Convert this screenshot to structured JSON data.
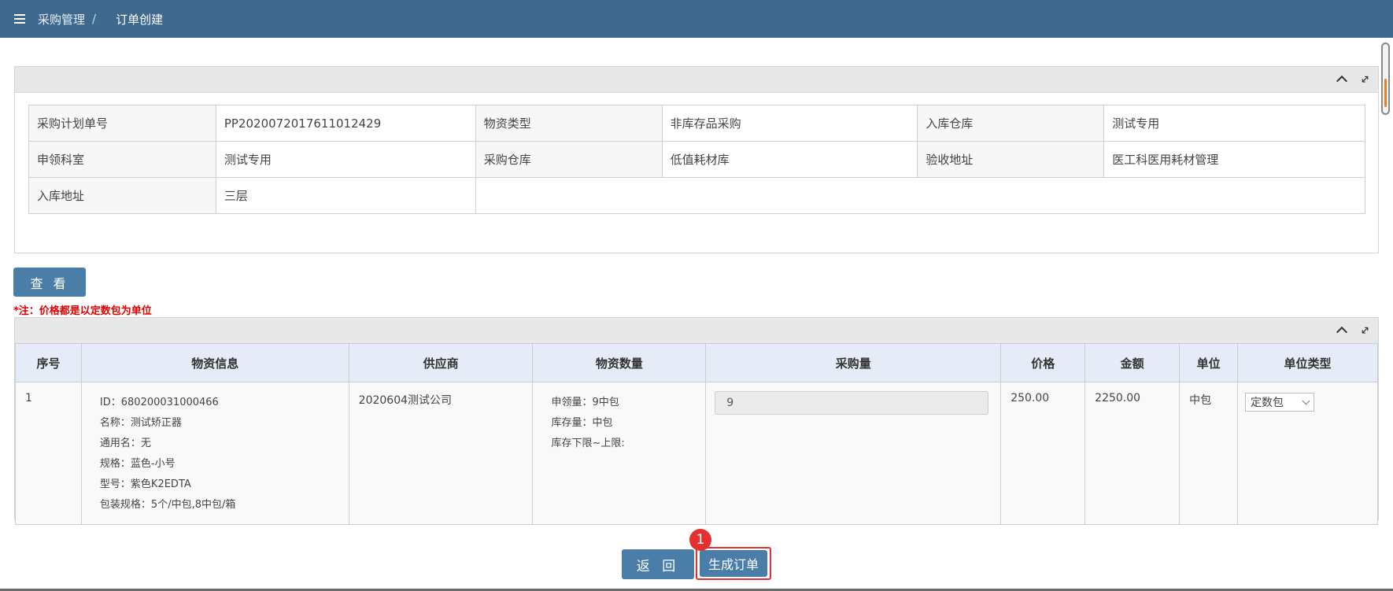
{
  "breadcrumb": {
    "parent": "采购管理",
    "separator": "/",
    "current": "订单创建"
  },
  "info": {
    "rows": [
      [
        {
          "label": "采购计划单号",
          "value": "PP2020072017611012429"
        },
        {
          "label": "物资类型",
          "value": "非库存品采购"
        },
        {
          "label": "入库仓库",
          "value": "测试专用"
        }
      ],
      [
        {
          "label": "申领科室",
          "value": "测试专用"
        },
        {
          "label": "采购仓库",
          "value": "低值耗材库"
        },
        {
          "label": "验收地址",
          "value": "医工科医用耗材管理"
        }
      ],
      [
        {
          "label": "入库地址",
          "value": "三层"
        }
      ]
    ]
  },
  "actions": {
    "view_label": "查 看",
    "back_label": "返 回",
    "generate_label": "生成订单",
    "badge": "1"
  },
  "note": "*注：价格都是以定数包为单位",
  "table": {
    "headers": [
      "序号",
      "物资信息",
      "供应商",
      "物资数量",
      "采购量",
      "价格",
      "金额",
      "单位",
      "单位类型"
    ],
    "row": {
      "index": "1",
      "material": [
        "ID：680200031000466",
        "名称：测试矫正器",
        "通用名：无",
        "规格：蓝色-小号",
        "型号：紫色K2EDTA",
        "包装规格：5个/中包,8中包/箱"
      ],
      "supplier": "2020604测试公司",
      "quantity": [
        "申领量：9中包",
        "库存量：中包",
        "库存下限~上限:"
      ],
      "purchase_qty": "9",
      "price": "250.00",
      "amount": "2250.00",
      "unit": "中包",
      "unit_type": "定数包"
    }
  },
  "icons": {
    "menu": "menu-icon",
    "collapse": "chevron-up-icon",
    "expand": "expand-icon"
  },
  "colors": {
    "header": "#3f6a8e",
    "button": "#4a7ea8",
    "highlight": "#e53030",
    "note": "#e00000"
  }
}
